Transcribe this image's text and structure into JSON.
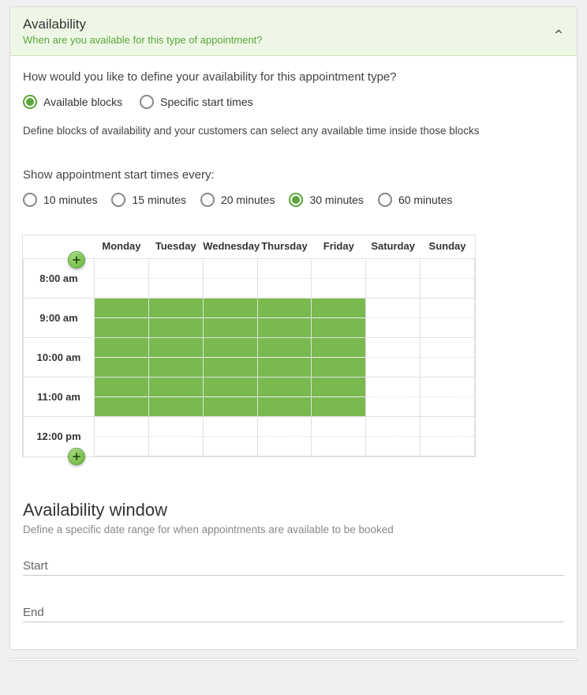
{
  "header": {
    "title": "Availability",
    "subtitle": "When are you available for this type of appointment?"
  },
  "define_question": "How would you like to define your availability for this appointment type?",
  "define_options": [
    {
      "label": "Available blocks",
      "selected": true
    },
    {
      "label": "Specific start times",
      "selected": false
    }
  ],
  "define_hint": "Define blocks of availability and your customers can select any available time inside those blocks",
  "interval_question": "Show appointment start times every:",
  "interval_options": [
    {
      "label": "10 minutes",
      "selected": false
    },
    {
      "label": "15 minutes",
      "selected": false
    },
    {
      "label": "20 minutes",
      "selected": false
    },
    {
      "label": "30 minutes",
      "selected": true
    },
    {
      "label": "60 minutes",
      "selected": false
    }
  ],
  "calendar": {
    "days": [
      "Monday",
      "Tuesday",
      "Wednesday",
      "Thursday",
      "Friday",
      "Saturday",
      "Sunday"
    ],
    "hours": [
      "8:00 am",
      "9:00 am",
      "10:00 am",
      "11:00 am",
      "12:00 pm"
    ],
    "slots_per_hour": 2,
    "filled": {
      "Monday": [
        false,
        false,
        true,
        true,
        true,
        true,
        true,
        true,
        false,
        false
      ],
      "Tuesday": [
        false,
        false,
        true,
        true,
        true,
        true,
        true,
        true,
        false,
        false
      ],
      "Wednesday": [
        false,
        false,
        true,
        true,
        true,
        true,
        true,
        true,
        false,
        false
      ],
      "Thursday": [
        false,
        false,
        true,
        true,
        true,
        true,
        true,
        true,
        false,
        false
      ],
      "Friday": [
        false,
        false,
        true,
        true,
        true,
        true,
        true,
        true,
        false,
        false
      ],
      "Saturday": [
        false,
        false,
        false,
        false,
        false,
        false,
        false,
        false,
        false,
        false
      ],
      "Sunday": [
        false,
        false,
        false,
        false,
        false,
        false,
        false,
        false,
        false,
        false
      ]
    }
  },
  "window": {
    "title": "Availability window",
    "subtitle": "Define a specific date range for when appointments are available to be booked",
    "start_label": "Start",
    "end_label": "End"
  }
}
